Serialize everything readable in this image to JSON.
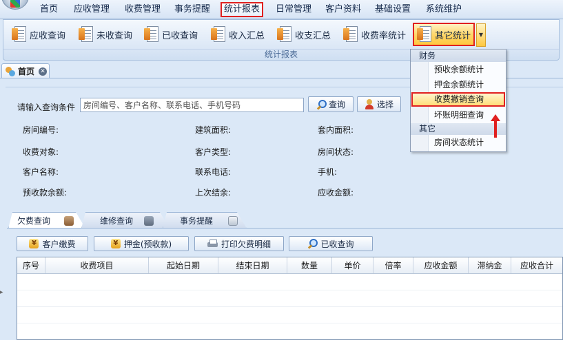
{
  "menubar": {
    "items": [
      "首页",
      "应收管理",
      "收费管理",
      "事务提醒",
      "统计报表",
      "日常管理",
      "客户资料",
      "基础设置",
      "系统维护"
    ],
    "active_index": 4
  },
  "ribbon": {
    "buttons": [
      "应收查询",
      "未收查询",
      "已收查询",
      "收入汇总",
      "收支汇总",
      "收费率统计",
      "其它统计"
    ],
    "group_label": "统计报表"
  },
  "doc_tab": {
    "label": "首页"
  },
  "query": {
    "prompt_label": "请输入查询条件",
    "search_placeholder": "房间编号、客户名称、联系电话、手机号码",
    "query_button": "查询",
    "select_button": "选择",
    "fields": [
      "房间编号:",
      "建筑面积:",
      "套内面积:",
      "收费对象:",
      "客户类型:",
      "房间状态:",
      "客户名称:",
      "联系电话:",
      "手机:",
      "预收款余额:",
      "上次结余:",
      "应收金额:"
    ]
  },
  "lower_tabs": [
    "欠费查询",
    "维修查询",
    "事务提醒"
  ],
  "actions": [
    "客户缴费",
    "押金(预收款)",
    "打印欠费明细",
    "已收查询"
  ],
  "grid": {
    "columns": [
      "序号",
      "收费项目",
      "起始日期",
      "结束日期",
      "数量",
      "单价",
      "倍率",
      "应收金额",
      "滞纳金",
      "应收合计"
    ]
  },
  "dropdown": {
    "section_finance": "财务",
    "finance_items": [
      "预收余额统计",
      "押金余额统计",
      "收费撤销查询",
      "坏账明细查询"
    ],
    "highlighted_index": 2,
    "section_other": "其它",
    "other_items": [
      "房间状态统计"
    ]
  },
  "colors": {
    "highlight_border": "#e02020",
    "accent": "#2e6fc4"
  }
}
